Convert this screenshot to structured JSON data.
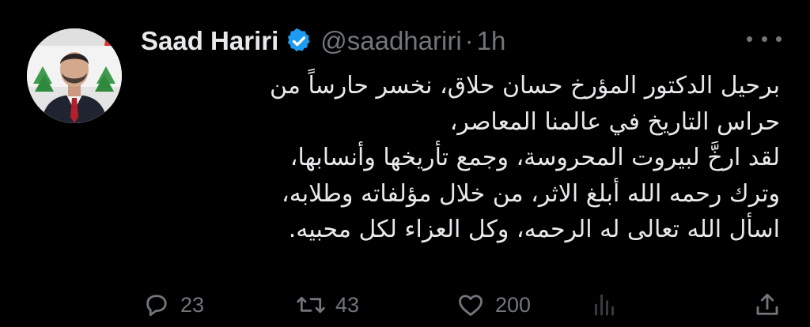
{
  "tweet": {
    "author": {
      "name": "Saad Hariri",
      "handle": "@saadhariri",
      "verified": true
    },
    "separator": "·",
    "time": "1h",
    "body_lines": [
      "برحيل الدكتور المؤرخ حسان حلاق، نخسر حارساً من",
      "حراس التاريخ في عالمنا المعاصر،",
      "لقد ارخَّ لبيروت المحروسة، وجمع تأريخها وأنسابها،",
      "وترك رحمه الله أبلغ الاثر، من خلال مؤلفاته وطلابه،",
      "اسأل الله تعالى له الرحمه، وكل العزاء لكل محبيه."
    ],
    "stats": {
      "replies": "23",
      "retweets": "43",
      "likes": "200"
    }
  },
  "icons": {
    "verified": "verified-badge-icon",
    "more": "more-options-icon",
    "reply": "reply-icon",
    "retweet": "retweet-icon",
    "like": "heart-icon",
    "views": "analytics-icon",
    "share": "share-icon"
  },
  "colors": {
    "background": "#000000",
    "text_primary": "#e7e9ea",
    "text_secondary": "#71767b",
    "verified_blue": "#1d9bf0"
  }
}
